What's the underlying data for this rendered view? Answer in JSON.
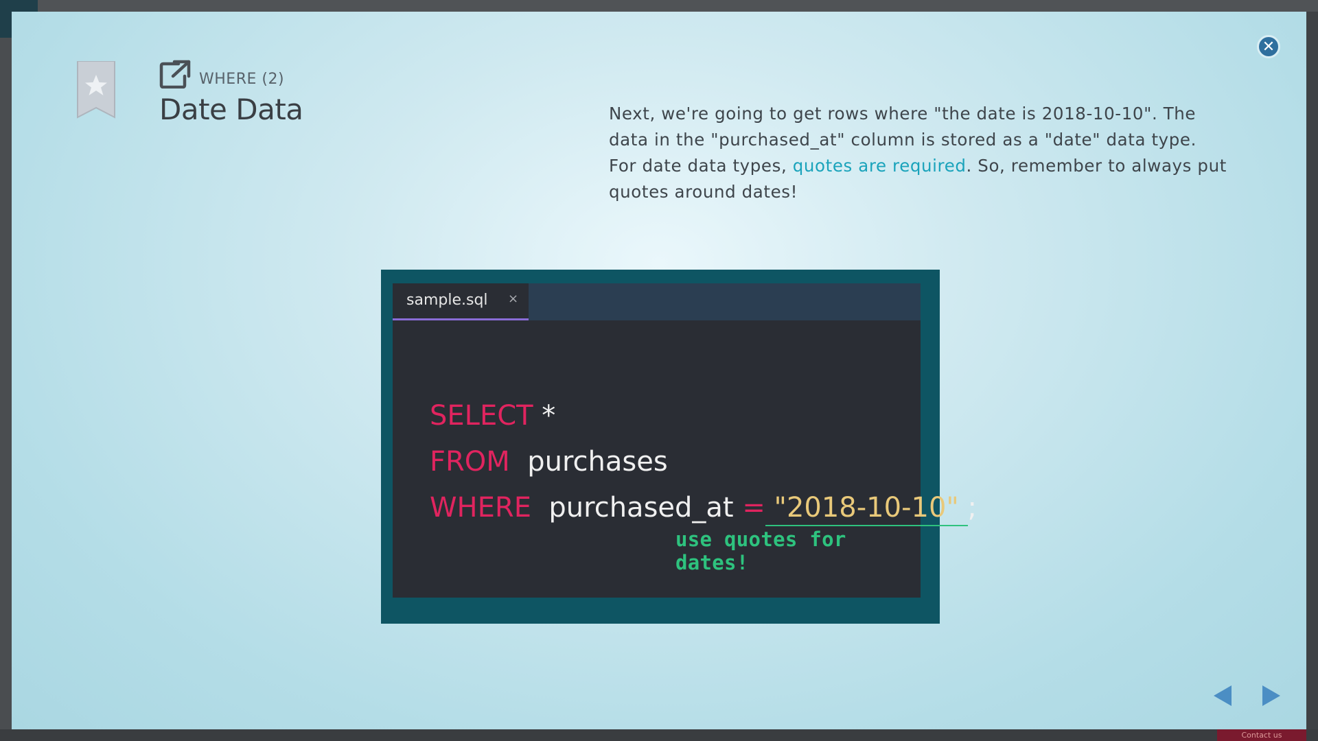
{
  "lesson": {
    "breadcrumb": "WHERE (2)",
    "title": "Date Data",
    "description_before": "Next, we're going to get rows where \"the date is 2018-10-10\". The data in the \"purchased_at\" column is stored as a \"date\" data type. For date data types, ",
    "description_link": "quotes are required",
    "description_after": ". So, remember to always put quotes around dates!"
  },
  "editor": {
    "tab_label": "sample.sql",
    "tab_close": "×",
    "code": {
      "line1_keyword": "SELECT",
      "line1_rest": " *",
      "line2_keyword": "FROM",
      "line2_rest": "  purchases",
      "line3_keyword": "WHERE",
      "line3_column": "  purchased_at ",
      "line3_operator": "=",
      "line3_value": " \"2018-10-10\" ",
      "line3_end": ";"
    },
    "annotation": "use quotes for dates!"
  },
  "controls": {
    "close_glyph": "✕"
  },
  "footer": {
    "contact_label": "Contact us"
  },
  "colors": {
    "keyword": "#e0245f",
    "string": "#e9c97a",
    "annotation": "#2ec27e",
    "link": "#1aa3bb",
    "frame": "#0e5563"
  },
  "icons": {
    "bookmark": "bookmark-star-icon",
    "external": "external-link-icon",
    "close": "close-icon",
    "prev": "prev-arrow-icon",
    "next": "next-arrow-icon"
  }
}
